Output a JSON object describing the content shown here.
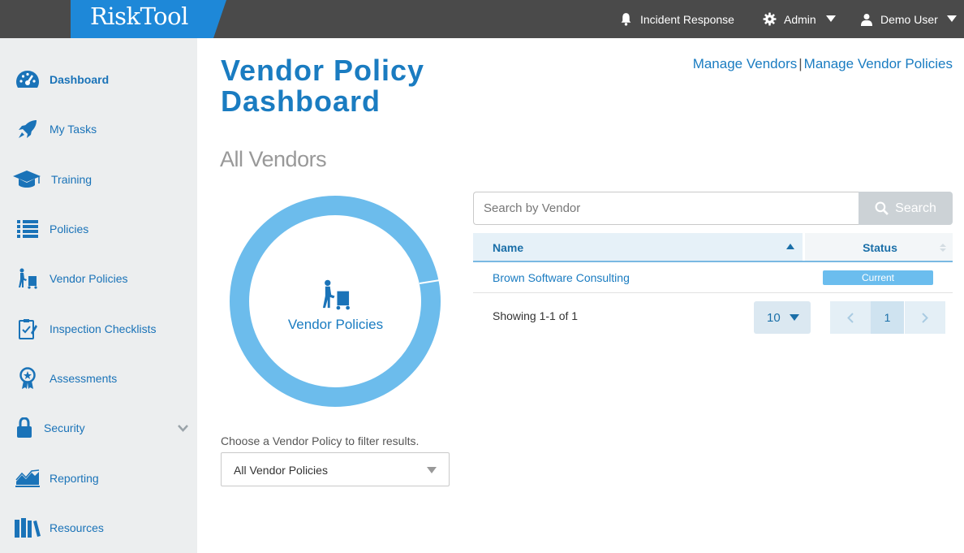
{
  "app": {
    "logo": "RiskTool"
  },
  "topbar": {
    "incident_label": "Incident Response",
    "admin_label": "Admin",
    "user_label": "Demo User"
  },
  "sidebar": {
    "items": [
      {
        "label": "Dashboard",
        "icon": "dashboard-gauge-icon",
        "active": true
      },
      {
        "label": "My Tasks",
        "icon": "rocket-icon"
      },
      {
        "label": "Training",
        "icon": "graduation-cap-icon"
      },
      {
        "label": "Policies",
        "icon": "list-icon"
      },
      {
        "label": "Vendor Policies",
        "icon": "hand-truck-icon"
      },
      {
        "label": "Inspection Checklists",
        "icon": "clipboard-check-icon"
      },
      {
        "label": "Assessments",
        "icon": "award-ribbon-icon"
      },
      {
        "label": "Security",
        "icon": "lock-icon"
      },
      {
        "label": "Reporting",
        "icon": "area-chart-icon"
      },
      {
        "label": "Resources",
        "icon": "books-icon"
      }
    ]
  },
  "main": {
    "title": "Vendor Policy Dashboard",
    "links": {
      "manage_vendors": "Manage Vendors",
      "separator": "|",
      "manage_vendor_policies": "Manage Vendor Policies"
    },
    "section_title": "All Vendors",
    "donut_label": "Vendor Policies",
    "filter_hint": "Choose a Vendor Policy to filter results.",
    "filter_value": "All Vendor Policies"
  },
  "search": {
    "placeholder": "Search by Vendor",
    "button_label": "Search"
  },
  "table": {
    "columns": [
      "Name",
      "Status"
    ],
    "rows": [
      {
        "name": "Brown Software Consulting",
        "status": "Current"
      }
    ]
  },
  "pagination": {
    "showing": "Showing 1-1 of 1",
    "page_size": "10",
    "current_page": "1"
  },
  "colors": {
    "brand": "#1a7cc1",
    "logo_bg": "#1e88d8",
    "donut": "#6cbcec",
    "topbar": "#4a4a4a"
  }
}
